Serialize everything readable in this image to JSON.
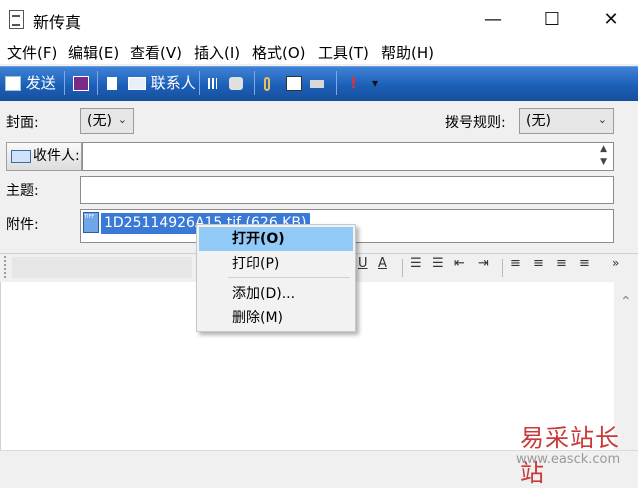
{
  "window": {
    "title": "新传真",
    "minimize": "—",
    "maximize": "☐",
    "close": "✕"
  },
  "menu": [
    "文件(F)",
    "编辑(E)",
    "查看(V)",
    "插入(I)",
    "格式(O)",
    "工具(T)",
    "帮助(H)"
  ],
  "toolbar": {
    "send_label": "发送",
    "contacts_label": "联系人",
    "priority_glyph": "!",
    "dropdown_glyph": "▾"
  },
  "fields": {
    "cover_label": "封面:",
    "cover_value": "(无)",
    "dial_rule_label": "拨号规则:",
    "dial_rule_value": "(无)",
    "recipients_button": "收件人:",
    "recipients_value": "",
    "subject_label": "主题:",
    "subject_value": "",
    "attachment_label": "附件:",
    "attachment_file": "1D25114926A15.tif (626 KB)"
  },
  "format_bar": {
    "underline": "U",
    "font_color": "A",
    "overflow": "»"
  },
  "context_menu": {
    "items": [
      "打开(O)",
      "打印(P)",
      "添加(D)...",
      "删除(M)"
    ]
  },
  "watermark": {
    "title": "易采站长站",
    "url": "www.easck.com"
  },
  "colors": {
    "toolbar": "#1c5fb8",
    "selection": "#3a79d6",
    "menu_hover": "#91c9f7"
  }
}
